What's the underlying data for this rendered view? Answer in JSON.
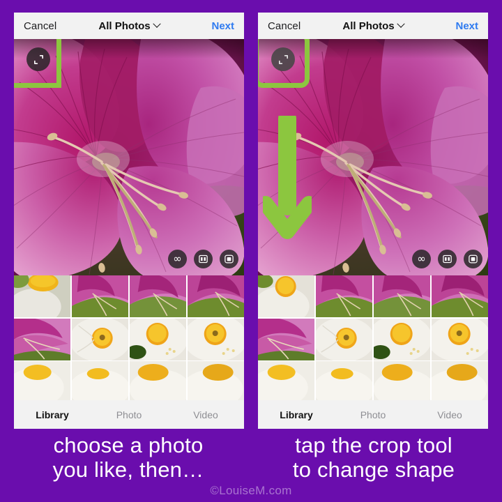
{
  "theme": {
    "background_purple": "#6A0DAD",
    "highlight_green": "#8CC63F",
    "link_blue": "#2F7BF0",
    "navbar_gray": "#F2F2F2"
  },
  "panels": [
    {
      "id": "left",
      "navbar": {
        "cancel_label": "Cancel",
        "title": "All Photos",
        "title_chevron_icon": "chevron-down-icon",
        "next_label": "Next"
      },
      "preview": {
        "description": "close-up of magenta orchid tree flower",
        "crop_tool": {
          "icon": "crop-icon",
          "state": "normal",
          "highlighted": true,
          "highlight_shape": "square"
        },
        "tools": [
          {
            "icon": "infinity-icon",
            "label": "Boomerang",
            "glyph": "∞"
          },
          {
            "icon": "layout-icon",
            "label": "Layout"
          },
          {
            "icon": "rounded-square-icon",
            "label": "Multi-capture"
          }
        ]
      },
      "tabs": [
        {
          "label": "Library",
          "active": true
        },
        {
          "label": "Photo",
          "active": false
        },
        {
          "label": "Video",
          "active": false
        }
      ],
      "caption": {
        "line1": "choose a photo",
        "line2": "you like, then…"
      }
    },
    {
      "id": "right",
      "navbar": {
        "cancel_label": "Cancel",
        "title": "All Photos",
        "title_chevron_icon": "chevron-down-icon",
        "next_label": "Next"
      },
      "preview": {
        "description": "close-up of magenta orchid tree flower",
        "crop_tool": {
          "icon": "crop-icon",
          "state": "pressed",
          "highlighted": true,
          "highlight_shape": "rounded"
        },
        "tools": [
          {
            "icon": "infinity-icon",
            "label": "Boomerang",
            "glyph": "∞"
          },
          {
            "icon": "layout-icon",
            "label": "Layout"
          },
          {
            "icon": "rounded-square-icon",
            "label": "Multi-capture"
          }
        ],
        "annotation": {
          "icon": "down-arrow-icon",
          "points_to": "crop-tool"
        }
      },
      "tabs": [
        {
          "label": "Library",
          "active": true
        },
        {
          "label": "Photo",
          "active": false
        },
        {
          "label": "Video",
          "active": false
        }
      ],
      "caption": {
        "line1": "tap the crop tool",
        "line2": "to change shape"
      }
    }
  ],
  "watermark": "©LouiseM.com"
}
